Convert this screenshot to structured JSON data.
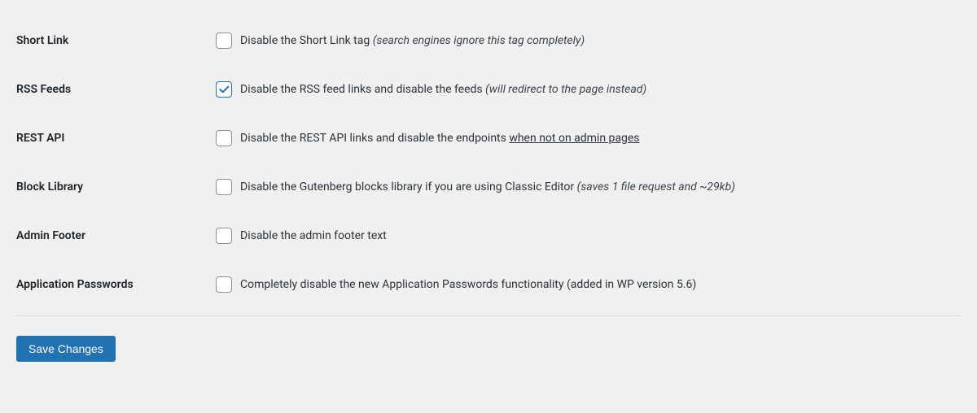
{
  "rows": [
    {
      "id": "short-link",
      "label": "Short Link",
      "checked": false,
      "text": "Disable the Short Link tag ",
      "hint": "(search engines ignore this tag completely)",
      "underline": ""
    },
    {
      "id": "rss-feeds",
      "label": "RSS Feeds",
      "checked": true,
      "text": "Disable the RSS feed links and disable the feeds ",
      "hint": "(will redirect to the page instead)",
      "underline": ""
    },
    {
      "id": "rest-api",
      "label": "REST API",
      "checked": false,
      "text": "Disable the REST API links and disable the endpoints ",
      "hint": "",
      "underline": "when not on admin pages"
    },
    {
      "id": "block-library",
      "label": "Block Library",
      "checked": false,
      "text": "Disable the Gutenberg blocks library if you are using Classic Editor ",
      "hint": "(saves 1 file request and ~29kb)",
      "underline": ""
    },
    {
      "id": "admin-footer",
      "label": "Admin Footer",
      "checked": false,
      "text": "Disable the admin footer text",
      "hint": "",
      "underline": ""
    },
    {
      "id": "application-passwords",
      "label": "Application Passwords",
      "checked": false,
      "text": "Completely disable the new Application Passwords functionality (added in WP version 5.6)",
      "hint": "",
      "underline": ""
    }
  ],
  "save_label": "Save Changes"
}
